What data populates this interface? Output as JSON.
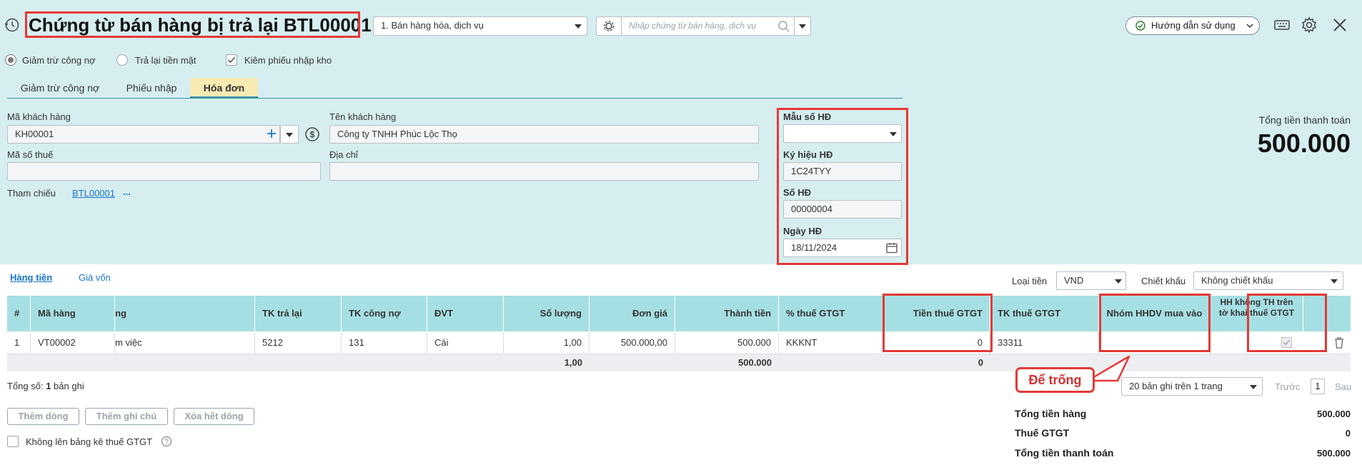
{
  "header": {
    "title": "Chứng từ bán hàng bị trả lại BTL00001",
    "type_select": "1. Bán hàng hóa, dịch vụ",
    "search_placeholder": "Nhập chứng từ bán hàng, dịch vụ",
    "help_label": "Hướng dẫn sử dụng"
  },
  "options": {
    "radio_reduce_debt": "Giảm trừ công nợ",
    "radio_cash_return": "Trả lại tiền mặt",
    "checkbox_stock_receipt": "Kiêm phiếu nhập kho"
  },
  "tabs": [
    {
      "label": "Giảm trừ công nợ"
    },
    {
      "label": "Phiếu nhập"
    },
    {
      "label": "Hóa đơn"
    }
  ],
  "customer": {
    "code_label": "Mã khách hàng",
    "code_value": "KH00001",
    "name_label": "Tên khách hàng",
    "name_value": "Công ty TNHH Phúc Lộc Thọ",
    "tax_label": "Mã số thuế",
    "tax_value": "",
    "address_label": "Địa chỉ",
    "address_value": "",
    "ref_label": "Tham chiếu",
    "ref_value": "BTL00001",
    "ref_more": "..."
  },
  "invoice": {
    "template_label": "Mẫu số HĐ",
    "template_value": "",
    "symbol_label": "Ký hiệu HĐ",
    "symbol_value": "1C24TYY",
    "number_label": "Số HĐ",
    "number_value": "00000004",
    "date_label": "Ngày HĐ",
    "date_value": "18/11/2024"
  },
  "total_box": {
    "label": "Tổng tiền thanh toán",
    "value": "500.000"
  },
  "subtabs": [
    {
      "label": "Hàng tiền"
    },
    {
      "label": "Giá vốn"
    }
  ],
  "currency": {
    "label": "Loại tiền",
    "value": "VND"
  },
  "discount": {
    "label": "Chiết khấu",
    "value": "Không chiết khấu"
  },
  "table": {
    "headers": {
      "num": "#",
      "code": "Mã hàng",
      "name": "ng",
      "tk_return": "TK trả lại",
      "tk_debt": "TK công nợ",
      "unit": "ĐVT",
      "qty": "Số lượng",
      "price": "Đơn giá",
      "amount": "Thành tiền",
      "vat_pct": "% thuế GTGT",
      "vat_amount": "Tiền thuế GTGT",
      "tk_vat": "TK thuế GTGT",
      "group": "Nhóm HHDV mua vào",
      "not_declared": "HH không TH trên tờ khai thuế GTGT"
    },
    "rows": [
      {
        "num": "1",
        "code": "VT00002",
        "name": "m việc",
        "tk_return": "5212",
        "tk_debt": "131",
        "unit": "Cái",
        "qty": "1,00",
        "price": "500.000,00",
        "amount": "500.000",
        "vat_pct": "KKKNT",
        "vat_amount": "0",
        "tk_vat": "33311",
        "group": ""
      }
    ],
    "totals": {
      "qty": "1,00",
      "amount": "500.000",
      "vat_amount": "0"
    }
  },
  "callout": "Để trống",
  "footer": {
    "count_prefix": "Tổng số: ",
    "count_value": "1",
    "count_suffix": " bản ghi",
    "add_row": "Thêm dòng",
    "add_note": "Thêm ghi chú",
    "delete_all": "Xóa hết dòng",
    "no_vat_list": "Không lên bảng kê thuế GTGT",
    "page_size": "20 bản ghi trên 1 trang",
    "prev": "Trước",
    "page": "1",
    "next": "Sau"
  },
  "summary": {
    "goods_label": "Tổng tiền hàng",
    "goods_value": "500.000",
    "vat_label": "Thuế GTGT",
    "vat_value": "0",
    "total_label": "Tổng tiền thanh toán",
    "total_value": "500.000"
  },
  "colors": {
    "header_bg": "#d6eef0",
    "grid_header_bg": "#a6dfe3",
    "active_tab_bg": "#f8eab3",
    "highlight_red": "#e53935",
    "link_blue": "#1a73c8"
  }
}
